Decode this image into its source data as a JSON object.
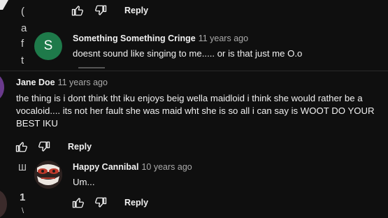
{
  "thread_top": {
    "reply_label": "Reply",
    "edge_chars": [
      "(",
      "a",
      "f",
      "t"
    ]
  },
  "comments": [
    {
      "author": "Something Something Cringe",
      "time": "11 years ago",
      "text": "doesnt sound like singing to me..... or is that just me O.o",
      "avatar_letter": "S",
      "avatar_color": "#1e7a4a"
    },
    {
      "author": "Jane Doe",
      "time": "11 years ago",
      "text": "the thing is i dont think tht iku enjoys beig wella maidloid i think she would rather be a vocaloid.... its not her fault she was maid wht she is so all i can say is WOOT DO YOUR BEST IKU",
      "reply_label": "Reply"
    },
    {
      "author": "Happy Cannibal",
      "time": "10 years ago",
      "text": "Um...",
      "reply_label": "Reply"
    }
  ],
  "edge_chars_bottom": [
    "Ш",
    "1",
    "\\"
  ]
}
